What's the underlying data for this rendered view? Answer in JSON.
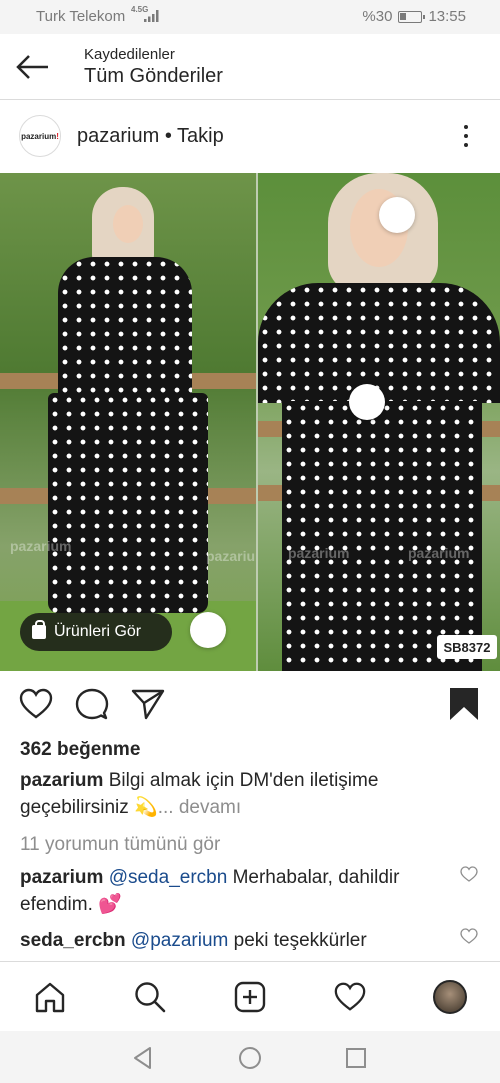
{
  "status_bar": {
    "carrier": "Turk Telekom",
    "network": "4.5G",
    "battery_text": "%30",
    "battery_level": 0.3,
    "time": "13:55"
  },
  "header": {
    "breadcrumb": "Kaydedilenler",
    "title": "Tüm Gönderiler"
  },
  "post": {
    "avatar_text": "pazarium",
    "account_line": "pazarium • Takip",
    "watermark": "pazarium",
    "shop_button": "Ürünleri Gör",
    "sku": "SB8372",
    "likes": "362 beğenme",
    "caption": {
      "username": "pazarium",
      "text": " Bilgi almak için DM'den iletişime geçebilirsiniz 💫",
      "more": "... devamı"
    },
    "view_all_comments": "11 yorumun tümünü gör",
    "comments": [
      {
        "username": "pazarium",
        "mention": "@seda_ercbn",
        "text": " Merhabalar, dahildir efendim. 💕"
      },
      {
        "username": "seda_ercbn",
        "mention": "@pazarium",
        "text": " peki teşekkürler"
      }
    ]
  },
  "icons": {
    "back": "arrow-left-icon",
    "more": "more-vertical-icon",
    "like": "heart-icon",
    "comment": "comment-icon",
    "share": "send-icon",
    "saved": "bookmark-filled-icon",
    "home": "home-icon",
    "search": "search-icon",
    "add": "plus-square-icon",
    "activity": "heart-icon",
    "profile": "avatar-icon"
  },
  "colors": {
    "link": "#1a4b8c",
    "grey": "#8e8e8e",
    "text": "#262626",
    "comment_heart": "#8e8e8e",
    "emoji_heart": "#e0202a"
  }
}
